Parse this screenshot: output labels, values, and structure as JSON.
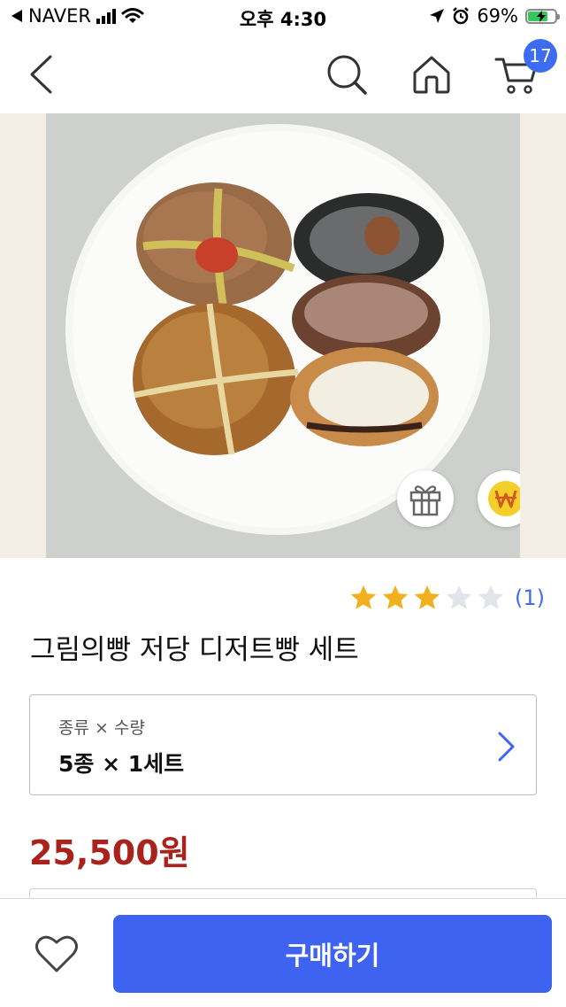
{
  "status_bar": {
    "carrier": "NAVER",
    "time": "오후 4:30",
    "battery_percent": "69%",
    "icons": [
      "back-triangle-icon",
      "signal-icon",
      "wifi-icon",
      "location-arrow-icon",
      "alarm-icon",
      "battery-charging-icon"
    ]
  },
  "nav": {
    "icons": [
      "back-chevron-icon",
      "search-icon",
      "home-icon",
      "cart-icon"
    ],
    "cart_count": "17"
  },
  "product": {
    "floating_icons": [
      "gift-icon",
      "won-coin-icon"
    ],
    "rating": {
      "stars_filled": 3,
      "stars_total": 5,
      "count_text": "(1)"
    },
    "title": "그림의빵 저당 디저트빵 세트",
    "option": {
      "label": "종류 × 수량",
      "value": "5종 × 1세트"
    },
    "price": "25,500원"
  },
  "bottom_bar": {
    "wish_icon": "heart-icon",
    "buy_label": "구매하기"
  },
  "colors": {
    "accent": "#3d63f0",
    "price": "#a9231c",
    "star_filled": "#f2b01e",
    "star_empty": "#e2e4ea"
  }
}
